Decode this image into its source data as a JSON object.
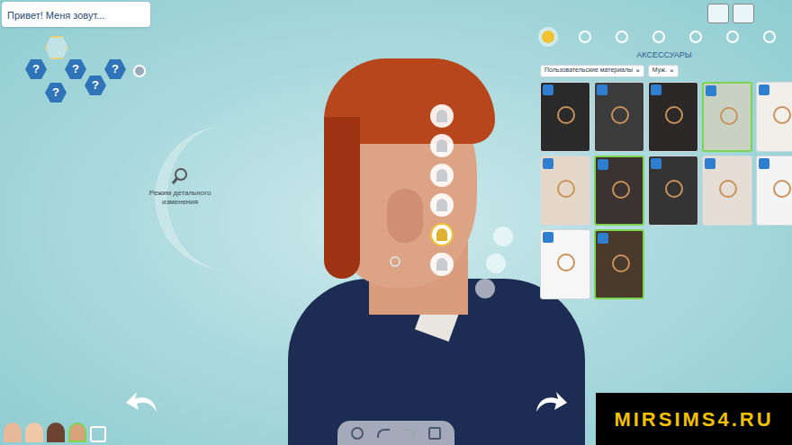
{
  "name_field": {
    "text": "Привет! Меня зовут..."
  },
  "traits": [
    {
      "label": "?"
    },
    {
      "label": "?"
    },
    {
      "label": "?"
    },
    {
      "label": "?"
    },
    {
      "label": "?"
    }
  ],
  "detail_mode": {
    "label": "Режим детального изменения"
  },
  "category_tabs": [
    {
      "selected": true
    },
    {
      "selected": false
    },
    {
      "selected": false
    },
    {
      "selected": false
    },
    {
      "selected": false
    },
    {
      "selected": false
    },
    {
      "selected": false
    }
  ],
  "section_title": "АКСЕССУАРЫ",
  "filters": [
    {
      "label": "Пользовательские материалы",
      "remove": "×"
    },
    {
      "label": "Муж.",
      "remove": "×"
    }
  ],
  "items": [
    {
      "selected": false
    },
    {
      "selected": false
    },
    {
      "selected": false
    },
    {
      "selected": true
    },
    {
      "selected": false
    },
    {
      "selected": false
    },
    {
      "selected": true
    },
    {
      "selected": false
    },
    {
      "selected": false
    },
    {
      "selected": false
    },
    {
      "selected": false
    },
    {
      "selected": true
    }
  ],
  "accessory_slots": [
    {
      "selected": false
    },
    {
      "selected": false
    },
    {
      "selected": false
    },
    {
      "selected": false
    },
    {
      "selected": true
    },
    {
      "selected": false
    }
  ],
  "household": [
    {
      "selected": false
    },
    {
      "selected": false
    },
    {
      "selected": false
    },
    {
      "selected": true
    }
  ],
  "watermark": "MIRSIMS4.RU"
}
